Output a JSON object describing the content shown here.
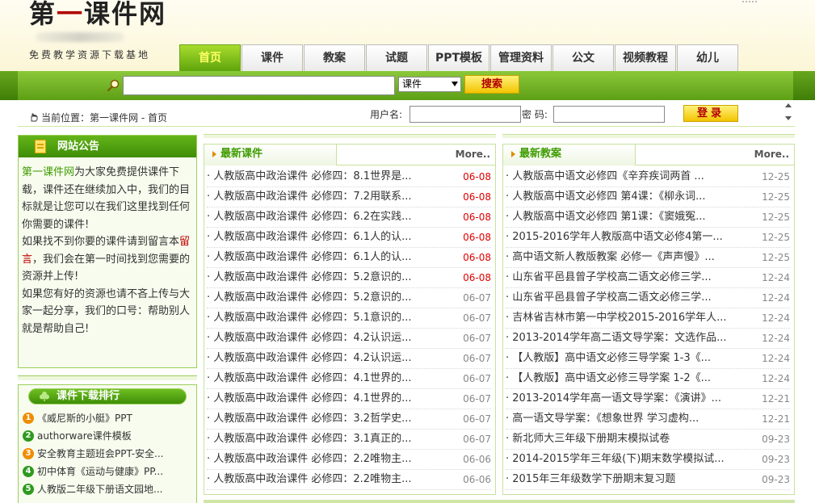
{
  "header": {
    "logo_part1": "第",
    "logo_part2": "一",
    "logo_part3": "课件网",
    "logo_sub": "免费教学资源下载基地"
  },
  "nav": {
    "tabs": [
      {
        "label": "首页",
        "active": true
      },
      {
        "label": "课件"
      },
      {
        "label": "教案"
      },
      {
        "label": "试题"
      },
      {
        "label": "PPT模板"
      },
      {
        "label": "管理资料"
      },
      {
        "label": "公文"
      },
      {
        "label": "视频教程"
      },
      {
        "label": "幼儿"
      }
    ]
  },
  "search": {
    "category": "课件",
    "button": "搜索"
  },
  "breadcrumb": "当前位置：第一课件网 - 首页",
  "login": {
    "username_label": "用户名:",
    "password_label": "密 码:",
    "button": "登录"
  },
  "notice": {
    "title": "网站公告",
    "site_name": "第一课件网",
    "p1": "为大家免费提供课件下载，课件还在继续加入中，我们的目标就是让您可以在我们这里找到任何你需要的课件!",
    "p2a": "如果找不到你要的课件请到留言本",
    "p2_link": "留言",
    "p2b": "，我们会在第一时间找到您需要的资源并上传!",
    "p3": "如果您有好的资源也请不吝上传与大家一起分享，我们的口号：帮助别人就是帮助自己!"
  },
  "ranking": {
    "title": "课件下载排行",
    "badge_colors": [
      "#f08c00",
      "#2e9a1e",
      "#f08c00",
      "#2e9a1e",
      "#2e9a1e"
    ],
    "items": [
      {
        "num": "1",
        "text": "《威尼斯的小艇》PPT"
      },
      {
        "num": "2",
        "text": "authorware课件模板"
      },
      {
        "num": "3",
        "text": "安全教育主题班会PPT-安全..."
      },
      {
        "num": "4",
        "text": "初中体育《运动与健康》PP..."
      },
      {
        "num": "5",
        "text": "人教版二年级下册语文园地..."
      }
    ]
  },
  "latest_courseware": {
    "title": "最新课件",
    "more": "More..",
    "items": [
      {
        "title": "· 人教版高中政治课件 必修四：8.1世界是...",
        "date": "06-08",
        "new": true
      },
      {
        "title": "· 人教版高中政治课件 必修四：7.2用联系...",
        "date": "06-08",
        "new": true
      },
      {
        "title": "· 人教版高中政治课件 必修四：6.2在实践...",
        "date": "06-08",
        "new": true
      },
      {
        "title": "· 人教版高中政治课件 必修四：6.1人的认...",
        "date": "06-08",
        "new": true
      },
      {
        "title": "· 人教版高中政治课件 必修四：6.1人的认...",
        "date": "06-08",
        "new": true
      },
      {
        "title": "· 人教版高中政治课件 必修四：5.2意识的...",
        "date": "06-08",
        "new": true
      },
      {
        "title": "· 人教版高中政治课件 必修四：5.2意识的...",
        "date": "06-07"
      },
      {
        "title": "· 人教版高中政治课件 必修四：5.1意识的...",
        "date": "06-07"
      },
      {
        "title": "· 人教版高中政治课件 必修四：4.2认识运...",
        "date": "06-07"
      },
      {
        "title": "· 人教版高中政治课件 必修四：4.2认识运...",
        "date": "06-07"
      },
      {
        "title": "· 人教版高中政治课件 必修四：4.1世界的...",
        "date": "06-07"
      },
      {
        "title": "· 人教版高中政治课件 必修四：4.1世界的...",
        "date": "06-07"
      },
      {
        "title": "· 人教版高中政治课件 必修四：3.2哲学史...",
        "date": "06-07"
      },
      {
        "title": "· 人教版高中政治课件 必修四：3.1真正的...",
        "date": "06-07"
      },
      {
        "title": "· 人教版高中政治课件 必修四：2.2唯物主...",
        "date": "06-06"
      },
      {
        "title": "· 人教版高中政治课件 必修四：2.2唯物主...",
        "date": "06-06"
      }
    ]
  },
  "latest_lessons": {
    "title": "最新教案",
    "more": "More..",
    "items": [
      {
        "title": "· 人教版高中语文必修四《辛弃疾词两首 ...",
        "date": "12-25"
      },
      {
        "title": "· 人教版高中语文必修四 第4课：《柳永词...",
        "date": "12-25"
      },
      {
        "title": "· 人教版高中语文必修四 第1课：《窦娥冤...",
        "date": "12-25"
      },
      {
        "title": "· 2015-2016学年人教版高中语文必修4第一...",
        "date": "12-25"
      },
      {
        "title": "· 高中语文新人教版教案 必修一《声声慢》...",
        "date": "12-25"
      },
      {
        "title": "· 山东省平邑县曾子学校高二语文必修三学...",
        "date": "12-24"
      },
      {
        "title": "· 山东省平邑县曾子学校高二语文必修三学...",
        "date": "12-24"
      },
      {
        "title": "· 吉林省吉林市第一中学校2015-2016学年人...",
        "date": "12-24"
      },
      {
        "title": "· 2013-2014学年高二语文导学案：文选作品...",
        "date": "12-24"
      },
      {
        "title": "· 【人教版】高中语文必修三导学案 1-3《...",
        "date": "12-24"
      },
      {
        "title": "· 【人教版】高中语文必修三导学案 1-2《...",
        "date": "12-24"
      },
      {
        "title": "· 2013-2014学年高一语文导学案：《演讲》...",
        "date": "12-21"
      },
      {
        "title": "· 高一语文导学案：《想象世界 学习虚构...",
        "date": "12-21"
      },
      {
        "title": "· 新北师大三年级下册期末模拟试卷",
        "date": "09-23"
      },
      {
        "title": "· 2014-2015学年三年级(下)期末数学模拟试...",
        "date": "09-23"
      },
      {
        "title": "· 2015年三年级数学下册期末复习题",
        "date": "09-23"
      }
    ]
  }
}
